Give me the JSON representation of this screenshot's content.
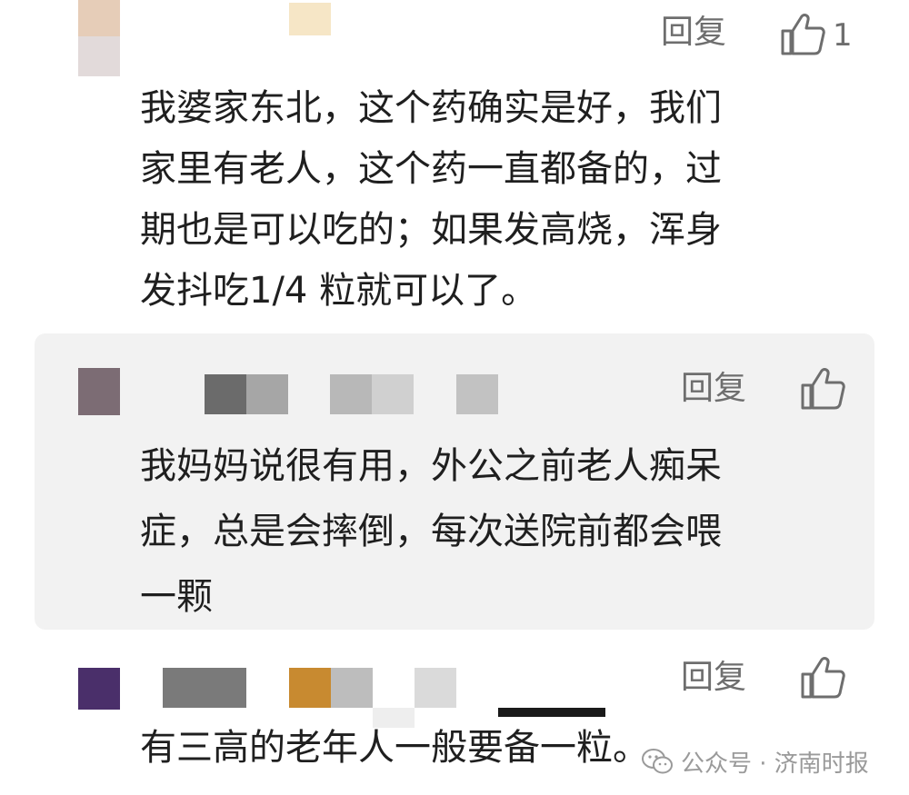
{
  "comments": [
    {
      "reply_label": "回复",
      "like_count": "1",
      "text_lines": [
        "我婆家东北，这个药确实是好，我们",
        "家里有老人，这个药一直都备的，过",
        "期也是可以吃的；如果发高烧，浑身",
        "发抖吃1/4 粒就可以了。"
      ]
    },
    {
      "reply_label": "回复",
      "text_lines": [
        "我妈妈说很有用，外公之前老人痴呆",
        "症，总是会摔倒，每次送院前都会喂",
        "一颗"
      ]
    },
    {
      "reply_label": "回复",
      "text_lines": [
        "有三高的老年人一般要备一粒。"
      ]
    }
  ],
  "watermark": {
    "text": "公众号 · 济南时报"
  },
  "icons": {
    "like": "thumbs-up-icon",
    "watermark": "wechat-icon"
  }
}
